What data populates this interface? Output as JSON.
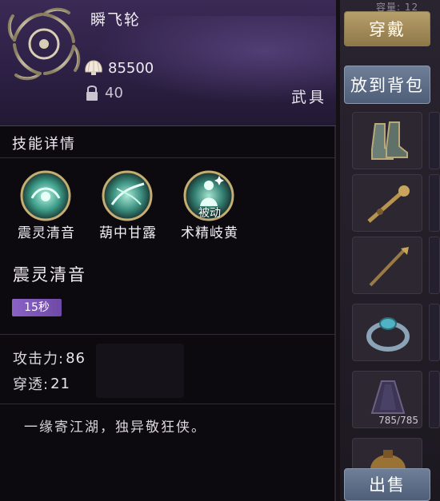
{
  "item": {
    "name": "瞬飞轮",
    "price": "85500",
    "level": "40",
    "type": "武具"
  },
  "skills_section": {
    "title": "技能详情",
    "skills": [
      {
        "label": "震灵清音",
        "passive_tag": ""
      },
      {
        "label": "葫中甘露",
        "passive_tag": ""
      },
      {
        "label": "术精岐黄",
        "passive_tag": "被动"
      }
    ]
  },
  "selected_skill": {
    "name": "震灵清音",
    "cooldown": "15秒"
  },
  "stats": [
    {
      "label": "攻击力:",
      "value": "86"
    },
    {
      "label": "穿透:",
      "value": "21"
    }
  ],
  "flavor_text": "一缘寄江湖，独异敬狂侠。",
  "actions": {
    "wear": "穿戴",
    "stow": "放到背包",
    "sell": "出售"
  },
  "inventory": {
    "header_fragment": "容量: 12",
    "slot_count_text": "785/785"
  },
  "icons": {
    "currency": "shell-icon",
    "level_lock": "lock-icon",
    "emblem": "wheel-emblem-icon"
  },
  "colors": {
    "header_purple": "#3a2a55",
    "cooldown_badge": "#8a62c7",
    "wear_button": "#b79f6b",
    "stow_button": "#6f7f98"
  }
}
